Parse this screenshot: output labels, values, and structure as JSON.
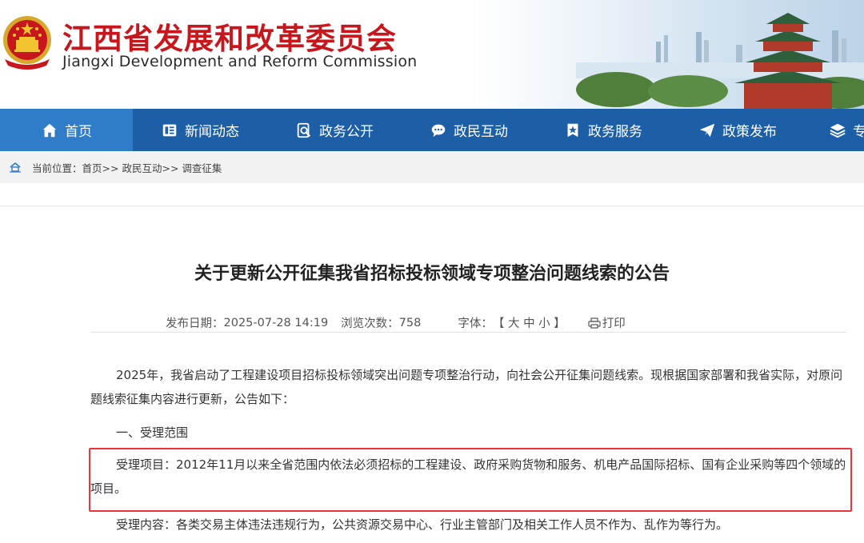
{
  "header": {
    "title_cn": "江西省发展和改革委员会",
    "title_en": "Jiangxi Development and Reform Commission",
    "brand_red": "#c8161d",
    "emblem": "national-emblem"
  },
  "nav": {
    "bg_color": "#1d5fa6",
    "active_color": "#2f7cc9",
    "items": [
      {
        "label": "首页",
        "icon": "home-icon"
      },
      {
        "label": "新闻动态",
        "icon": "news-icon"
      },
      {
        "label": "政务公开",
        "icon": "search-doc-icon"
      },
      {
        "label": "政民互动",
        "icon": "chat-icon"
      },
      {
        "label": "政务服务",
        "icon": "star-badge-icon"
      },
      {
        "label": "政策发布",
        "icon": "send-icon"
      },
      {
        "label": "专",
        "icon": "layers-icon"
      }
    ]
  },
  "breadcrumb": {
    "prefix": "当前位置：",
    "items": [
      "首页>>",
      "政民互动>>",
      "调查征集"
    ]
  },
  "article": {
    "title": "关于更新公开征集我省招标投标领域专项整治问题线索的公告",
    "publish_label": "发布日期：",
    "publish_date": "2025-07-28 14:19",
    "views_label": "浏览次数：",
    "views": "758",
    "font_label": "字体：",
    "font_options": "【 大 中 小 】",
    "print_label": "打印",
    "paragraphs": [
      "2025年，我省启动了工程建设项目招标投标领域突出问题专项整治行动，向社会公开征集问题线索。现根据国家部署和我省实际，对原问题线索征集内容进行更新，公告如下：",
      "一、受理范围",
      "受理项目：2012年11月以来全省范围内依法必须招标的工程建设、政府采购货物和服务、机电产品国际招标、国有企业采购等四个领域的项目。",
      "受理内容：各类交易主体违法违规行为，公共资源交易中心、行业主管部门及相关工作人员不作为、乱作为等行为。"
    ],
    "highlight_color": "#e8373c"
  }
}
